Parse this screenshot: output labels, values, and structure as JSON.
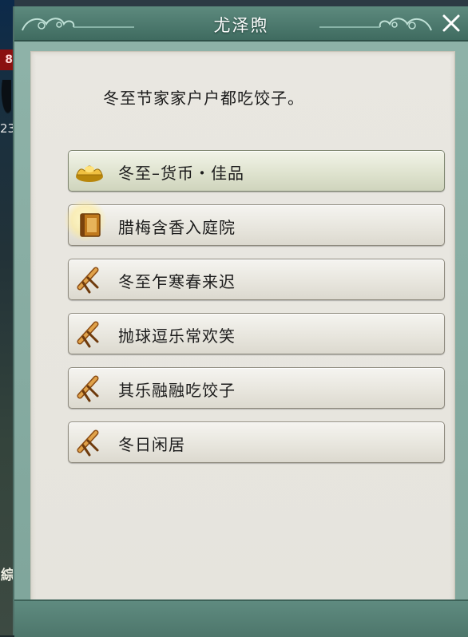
{
  "backdrop": {
    "badge_text": "8",
    "number_text": "23",
    "bottom_char": "綜"
  },
  "dialog": {
    "title": "尤泽煦",
    "prompt": "冬至节家家户户都吃饺子。",
    "options": [
      {
        "label": "冬至–货币・佳品",
        "icon": "gold-ingot-icon",
        "selected": true
      },
      {
        "label": "腊梅含香入庭院",
        "icon": "book-icon",
        "selected": false
      },
      {
        "label": "冬至乍寒春来迟",
        "icon": "scroll-icon",
        "selected": false
      },
      {
        "label": "抛球逗乐常欢笑",
        "icon": "scroll-icon",
        "selected": false
      },
      {
        "label": "其乐融融吃饺子",
        "icon": "scroll-icon",
        "selected": false
      },
      {
        "label": "冬日闲居",
        "icon": "scroll-icon",
        "selected": false
      }
    ]
  },
  "colors": {
    "frame_teal": "#7fa59b",
    "titlebar_teal": "#3f6b60",
    "parchment": "#e8e6df",
    "option_text": "#1c1c1c"
  }
}
